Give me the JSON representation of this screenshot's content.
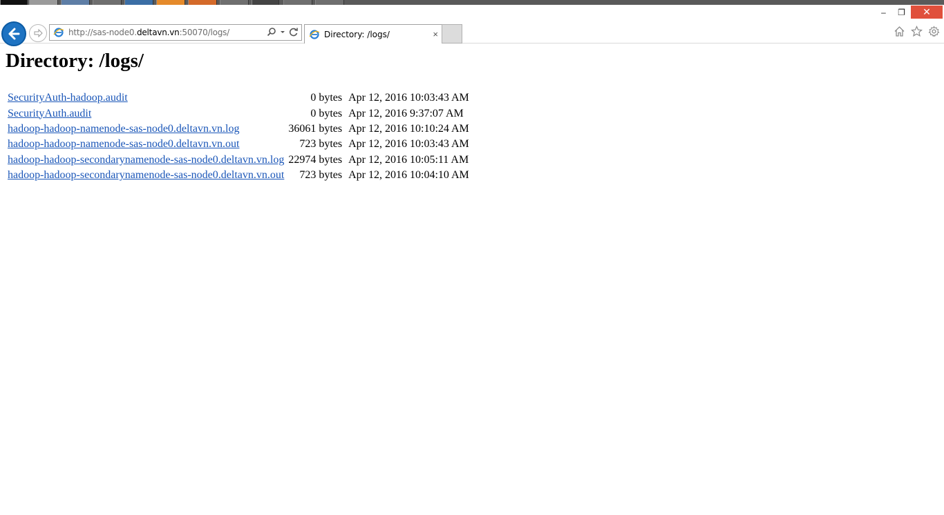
{
  "browser": {
    "url_prefix": "http://sas-node0.",
    "url_domain": "deltavn.vn",
    "url_suffix": ":50070/logs/",
    "tab_title": "Directory: /logs/",
    "window_buttons": {
      "minimize": "–",
      "restore": "❐",
      "close": "✕"
    },
    "tab_close": "×",
    "accent_color": "#1e73c2",
    "close_color": "#e0503c"
  },
  "page": {
    "title": "Directory: /logs/",
    "files": [
      {
        "name": "SecurityAuth-hadoop.audit",
        "size": "0 bytes",
        "date": "Apr 12, 2016 10:03:43 AM"
      },
      {
        "name": "SecurityAuth.audit",
        "size": "0 bytes",
        "date": "Apr 12, 2016 9:37:07 AM"
      },
      {
        "name": "hadoop-hadoop-namenode-sas-node0.deltavn.vn.log",
        "size": "36061 bytes",
        "date": "Apr 12, 2016 10:10:24 AM"
      },
      {
        "name": "hadoop-hadoop-namenode-sas-node0.deltavn.vn.out",
        "size": "723 bytes",
        "date": "Apr 12, 2016 10:03:43 AM"
      },
      {
        "name": "hadoop-hadoop-secondarynamenode-sas-node0.deltavn.vn.log",
        "size": "22974 bytes",
        "date": "Apr 12, 2016 10:05:11 AM"
      },
      {
        "name": "hadoop-hadoop-secondarynamenode-sas-node0.deltavn.vn.out",
        "size": "723 bytes",
        "date": "Apr 12, 2016 10:04:10 AM"
      }
    ]
  },
  "icons": [
    "back-arrow-icon",
    "forward-arrow-icon",
    "ie-logo-icon",
    "search-icon",
    "dropdown-icon",
    "refresh-icon",
    "home-icon",
    "favorites-star-icon",
    "settings-gear-icon"
  ]
}
